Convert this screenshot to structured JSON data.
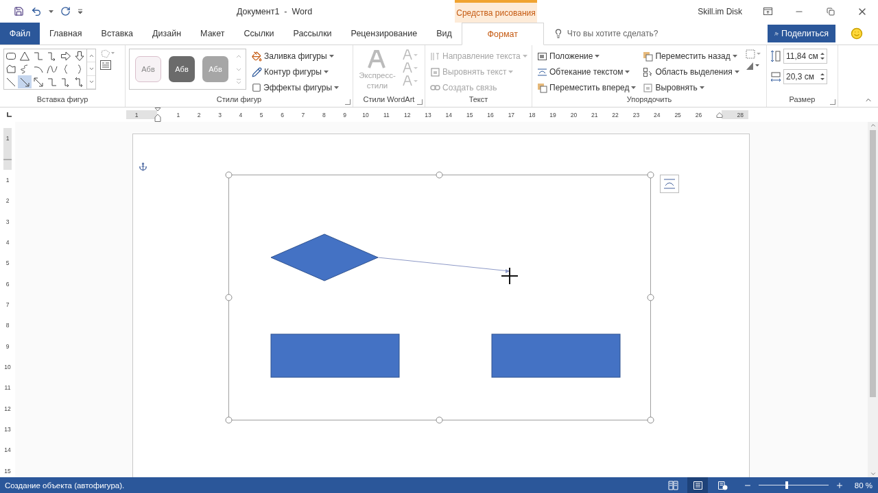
{
  "title_bar": {
    "title": "Документ1  -  Word",
    "context_label": "Средства рисования",
    "account": "Skill.im Disk"
  },
  "tabs": [
    {
      "label": "Файл",
      "kind": "file",
      "selected": false
    },
    {
      "label": "Главная",
      "kind": "tab",
      "selected": false
    },
    {
      "label": "Вставка",
      "kind": "tab",
      "selected": false
    },
    {
      "label": "Дизайн",
      "kind": "tab",
      "selected": false
    },
    {
      "label": "Макет",
      "kind": "tab",
      "selected": false
    },
    {
      "label": "Ссылки",
      "kind": "tab",
      "selected": false
    },
    {
      "label": "Рассылки",
      "kind": "tab",
      "selected": false
    },
    {
      "label": "Рецензирование",
      "kind": "tab",
      "selected": false
    },
    {
      "label": "Вид",
      "kind": "tab",
      "selected": false
    },
    {
      "label": "Формат",
      "kind": "context",
      "selected": true
    }
  ],
  "tell_me": {
    "placeholder": "Что вы хотите сделать?"
  },
  "share": {
    "label": "Поделиться"
  },
  "insert_shapes": {
    "label": "Вставка фигур",
    "shapes": [
      {
        "kind": "rounded-rect",
        "selected": false
      },
      {
        "kind": "triangle",
        "selected": false
      },
      {
        "kind": "elbow",
        "selected": false
      },
      {
        "kind": "elbow-arrow",
        "selected": false
      },
      {
        "kind": "right-arrow",
        "selected": false
      },
      {
        "kind": "down-arrow",
        "selected": false
      },
      {
        "kind": "freeform",
        "selected": false
      },
      {
        "kind": "scribble",
        "selected": false
      },
      {
        "kind": "arc",
        "selected": false
      },
      {
        "kind": "curve",
        "selected": false
      },
      {
        "kind": "left-brace",
        "selected": false
      },
      {
        "kind": "right-brace",
        "selected": false
      },
      {
        "kind": "line",
        "selected": false
      },
      {
        "kind": "line-arrow",
        "selected": true
      },
      {
        "kind": "double-arrow",
        "selected": false
      },
      {
        "kind": "elbow",
        "selected": false
      },
      {
        "kind": "elbow-arrow",
        "selected": false
      },
      {
        "kind": "elbow-double-arrow",
        "selected": false
      }
    ]
  },
  "shape_styles": {
    "label": "Стили фигур",
    "swatches": [
      {
        "text": "Абв",
        "color": "#f7f2f5"
      },
      {
        "text": "Абв",
        "color": "#6b6b6b"
      },
      {
        "text": "Абв",
        "color": "#a6a6a6"
      }
    ],
    "commands": [
      {
        "label": "Заливка фигуры",
        "kind": "fill"
      },
      {
        "label": "Контур фигуры",
        "kind": "outline"
      },
      {
        "label": "Эффекты фигуры",
        "kind": "effects"
      }
    ]
  },
  "wordart_styles": {
    "label": "Стили WordArt",
    "quick_styles": "Экспресс-стили",
    "disabled": true
  },
  "text_group": {
    "label": "Текст",
    "commands": [
      {
        "label": "Направление текста",
        "kind": "direction",
        "disabled": true
      },
      {
        "label": "Выровнять текст",
        "kind": "align",
        "disabled": true
      },
      {
        "label": "Создать связь",
        "kind": "link",
        "disabled": true
      }
    ]
  },
  "arrange": {
    "label": "Упорядочить",
    "commands": [
      {
        "label": "Положение",
        "kind": "position"
      },
      {
        "label": "Обтекание текстом",
        "kind": "wrap"
      },
      {
        "label": "Переместить вперед",
        "kind": "forward"
      },
      {
        "label": "Переместить назад",
        "kind": "backward"
      },
      {
        "label": "Область выделения",
        "kind": "selection"
      },
      {
        "label": "Выровнять",
        "kind": "align"
      }
    ]
  },
  "size": {
    "label": "Размер",
    "height": "11,84 см",
    "width": "20,3 см"
  },
  "ruler": {
    "marks": [
      {
        "kind": "number",
        "label": "1"
      },
      {
        "kind": "indent"
      },
      {
        "kind": "number",
        "label": "1"
      },
      {
        "kind": "number",
        "label": "2"
      },
      {
        "kind": "number",
        "label": "3"
      },
      {
        "kind": "number",
        "label": "4"
      },
      {
        "kind": "number",
        "label": "5"
      },
      {
        "kind": "number",
        "label": "6"
      },
      {
        "kind": "number",
        "label": "7"
      },
      {
        "kind": "number",
        "label": "8"
      },
      {
        "kind": "number",
        "label": "9"
      },
      {
        "kind": "number",
        "label": "10"
      },
      {
        "kind": "number",
        "label": "11"
      },
      {
        "kind": "number",
        "label": "12"
      },
      {
        "kind": "number",
        "label": "13"
      },
      {
        "kind": "number",
        "label": "14"
      },
      {
        "kind": "number",
        "label": "15"
      },
      {
        "kind": "number",
        "label": "16"
      },
      {
        "kind": "number",
        "label": "17"
      },
      {
        "kind": "number",
        "label": "18"
      },
      {
        "kind": "number",
        "label": "19"
      },
      {
        "kind": "number",
        "label": "20"
      },
      {
        "kind": "number",
        "label": "21"
      },
      {
        "kind": "number",
        "label": "22"
      },
      {
        "kind": "number",
        "label": "23"
      },
      {
        "kind": "number",
        "label": "24"
      },
      {
        "kind": "number",
        "label": "25"
      },
      {
        "kind": "number",
        "label": "26"
      },
      {
        "kind": "right-indent"
      },
      {
        "kind": "number",
        "label": "28"
      }
    ]
  },
  "vertical_ruler": {
    "marks": [
      {
        "kind": "number",
        "label": "1"
      },
      {
        "kind": "margin"
      },
      {
        "kind": "number",
        "label": "1"
      },
      {
        "kind": "number",
        "label": "2"
      },
      {
        "kind": "number",
        "label": "3"
      },
      {
        "kind": "number",
        "label": "4"
      },
      {
        "kind": "number",
        "label": "5"
      },
      {
        "kind": "number",
        "label": "6"
      },
      {
        "kind": "number",
        "label": "7"
      },
      {
        "kind": "number",
        "label": "8"
      },
      {
        "kind": "number",
        "label": "9"
      },
      {
        "kind": "number",
        "label": "10"
      },
      {
        "kind": "number",
        "label": "11"
      },
      {
        "kind": "number",
        "label": "12"
      },
      {
        "kind": "number",
        "label": "13"
      },
      {
        "kind": "number",
        "label": "14"
      },
      {
        "kind": "number",
        "label": "15"
      }
    ]
  },
  "canvas": {
    "shapes": [
      {
        "kind": "diamond"
      },
      {
        "kind": "rectangle"
      },
      {
        "kind": "rectangle"
      },
      {
        "kind": "arrow"
      }
    ]
  },
  "status_bar": {
    "text": "Создание объекта (автофигура).",
    "views": [
      {
        "kind": "read",
        "selected": false
      },
      {
        "kind": "print",
        "selected": true
      },
      {
        "kind": "web",
        "selected": false
      }
    ],
    "zoom": {
      "level": 0.4,
      "label": "80 %"
    }
  }
}
